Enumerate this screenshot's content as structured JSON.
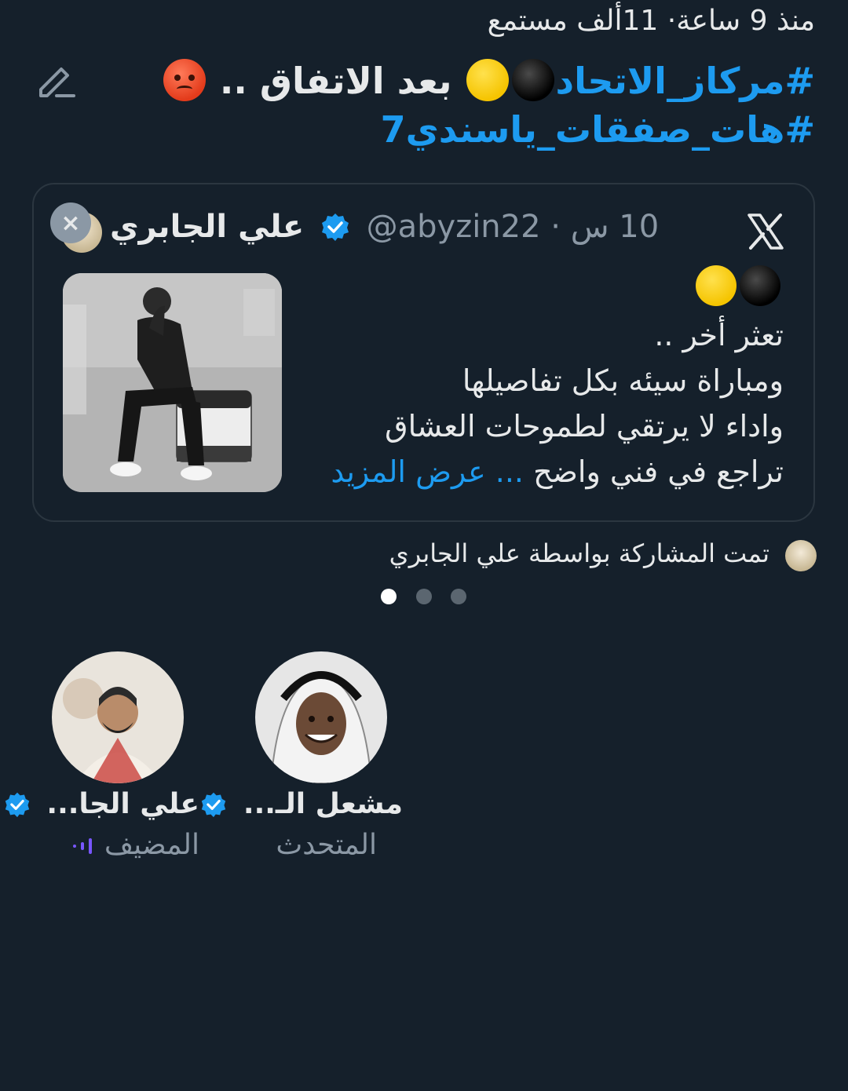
{
  "meta": {
    "text": "منذ 9 ساعة· 11ألف مستمع"
  },
  "title": {
    "hashtag1": "#مركاز_الاتحاد",
    "middle": "بعد الاتفاق ..",
    "hashtag2": "#هات_صفقات_ياسندي7"
  },
  "tweet": {
    "time": "10 س",
    "handle": "@abyzin22",
    "separator": "·",
    "name": "علي الجابري",
    "lines": [
      "تعثر أخر ..",
      "ومباراة سيئه بكل تفاصيلها",
      "واداء لا يرتقي لطموحات العشاق",
      "تراجع في فني واضح"
    ],
    "ellipsis": "...",
    "show_more": "عرض المزيد"
  },
  "shared_by": {
    "text": "تمت المشاركة بواسطة علي الجابري"
  },
  "pager": {
    "count": 3,
    "active_index": 0
  },
  "participants": [
    {
      "name": "علي الجا...",
      "role": "المضيف",
      "verified": true,
      "speaking": true
    },
    {
      "name": "مشعل الـ...",
      "role": "المتحدث",
      "verified": true,
      "speaking": false
    }
  ],
  "colors": {
    "background": "#15202b",
    "accent": "#1d9bf0",
    "secondary_text": "#8b98a5",
    "host_speaking": "#7856ff"
  },
  "icons": {
    "edit": "edit-pencil-icon",
    "x_logo": "x-logo-icon",
    "verified": "verified-badge-icon",
    "close": "close-icon",
    "speaking": "speaking-bars-icon"
  }
}
